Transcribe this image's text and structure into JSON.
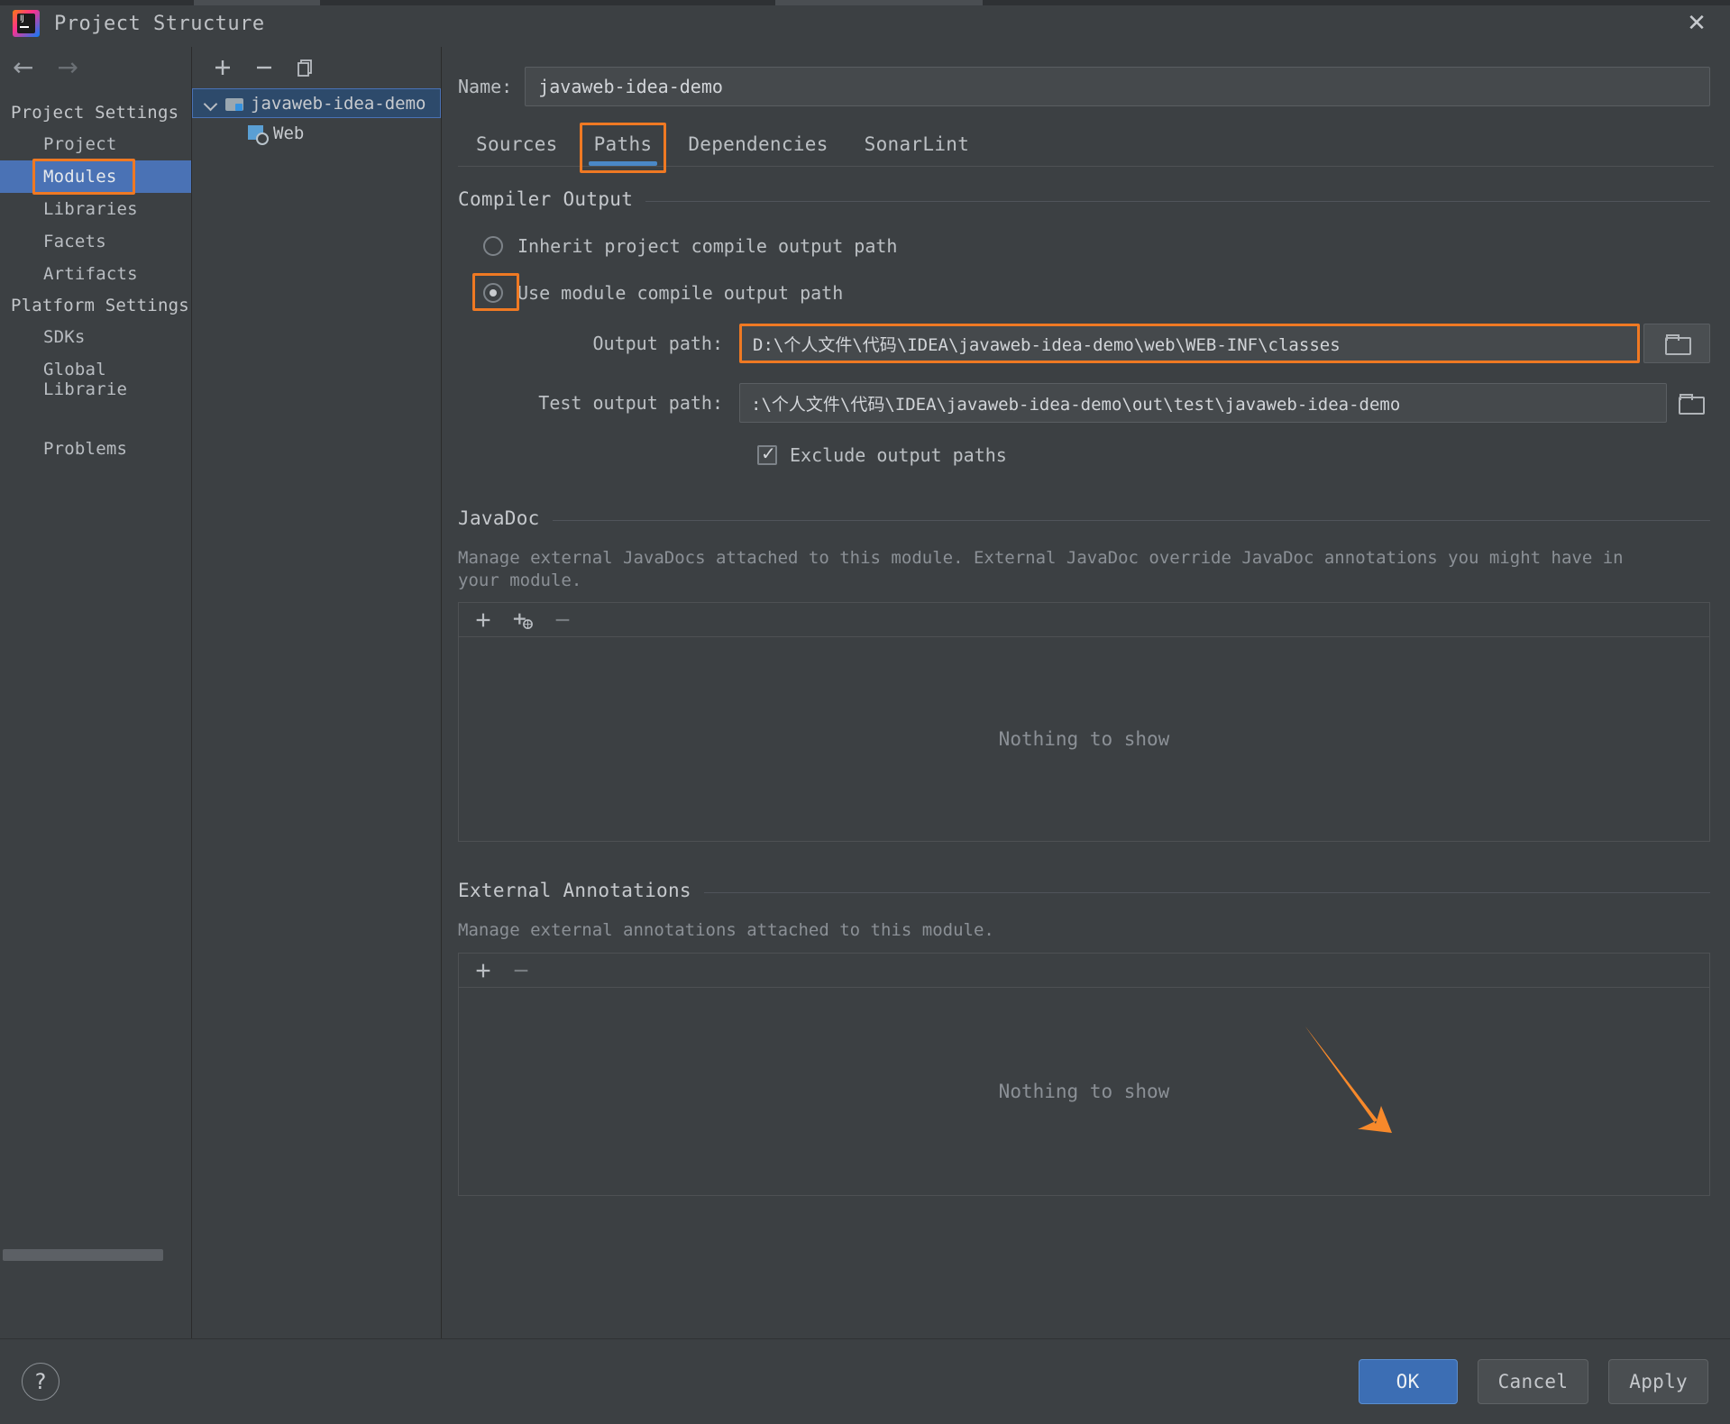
{
  "window": {
    "title": "Project Structure",
    "app_icon": "intellij-idea-icon",
    "close_icon": "close-icon"
  },
  "leftnav": {
    "back_icon": "arrow-left-icon",
    "forward_icon": "arrow-right-icon",
    "groups": [
      {
        "label": "Project Settings",
        "items": [
          {
            "label": "Project",
            "selected": false
          },
          {
            "label": "Modules",
            "selected": true,
            "annotated": true
          },
          {
            "label": "Libraries",
            "selected": false
          },
          {
            "label": "Facets",
            "selected": false
          },
          {
            "label": "Artifacts",
            "selected": false
          }
        ]
      },
      {
        "label": "Platform Settings",
        "items": [
          {
            "label": "SDKs",
            "selected": false
          },
          {
            "label": "Global Librarie",
            "selected": false
          }
        ]
      }
    ],
    "problems_label": "Problems"
  },
  "tree": {
    "toolbar": [
      {
        "name": "add-module-button",
        "glyph": "+"
      },
      {
        "name": "remove-module-button",
        "glyph": "−"
      },
      {
        "name": "copy-module-button",
        "glyph": "copy-icon"
      }
    ],
    "nodes": [
      {
        "label": "javaweb-idea-demo",
        "icon": "module-folder-icon",
        "selected": true,
        "expanded": true
      },
      {
        "label": "Web",
        "icon": "web-facet-icon",
        "selected": false,
        "child": true
      }
    ]
  },
  "main": {
    "name_label": "Name:",
    "name_value": "javaweb-idea-demo",
    "tabs": [
      {
        "label": "Sources",
        "active": false
      },
      {
        "label": "Paths",
        "active": true,
        "annotated": true
      },
      {
        "label": "Dependencies",
        "active": false
      },
      {
        "label": "SonarLint",
        "active": false
      }
    ],
    "compiler_output": {
      "title": "Compiler Output",
      "inherit_label": "Inherit project compile output path",
      "inherit_selected": false,
      "use_module_label": "Use module compile output path",
      "use_module_selected": true,
      "use_module_annotated": true,
      "output_path_label": "Output path:",
      "output_path_value": "D:\\个人文件\\代码\\IDEA\\javaweb-idea-demo\\web\\WEB-INF\\classes",
      "output_path_annotated": true,
      "test_output_path_label": "Test output path:",
      "test_output_path_value": ":\\个人文件\\代码\\IDEA\\javaweb-idea-demo\\out\\test\\javaweb-idea-demo",
      "exclude_label": "Exclude output paths",
      "exclude_checked": true,
      "browse_icon": "folder-browse-icon"
    },
    "javadoc": {
      "title": "JavaDoc",
      "description": "Manage external JavaDocs attached to this module. External JavaDoc override JavaDoc annotations you might have in your module.",
      "toolbar": [
        {
          "name": "add-javadoc-path-button",
          "glyph": "+"
        },
        {
          "name": "add-javadoc-url-button",
          "glyph": "+url"
        },
        {
          "name": "remove-javadoc-button",
          "glyph": "−"
        }
      ],
      "empty_text": "Nothing to show"
    },
    "external_annotations": {
      "title": "External Annotations",
      "description": "Manage external annotations attached to this module.",
      "toolbar": [
        {
          "name": "add-annotation-button",
          "glyph": "+"
        },
        {
          "name": "remove-annotation-button",
          "glyph": "−"
        }
      ],
      "empty_text": "Nothing to show"
    }
  },
  "footer": {
    "help_icon": "help-question-icon",
    "ok_label": "OK",
    "cancel_label": "Cancel",
    "apply_label": "Apply",
    "ok_annotated": true
  },
  "annotations": {
    "color": "#ef7923",
    "arrow_target": "ok-button"
  }
}
